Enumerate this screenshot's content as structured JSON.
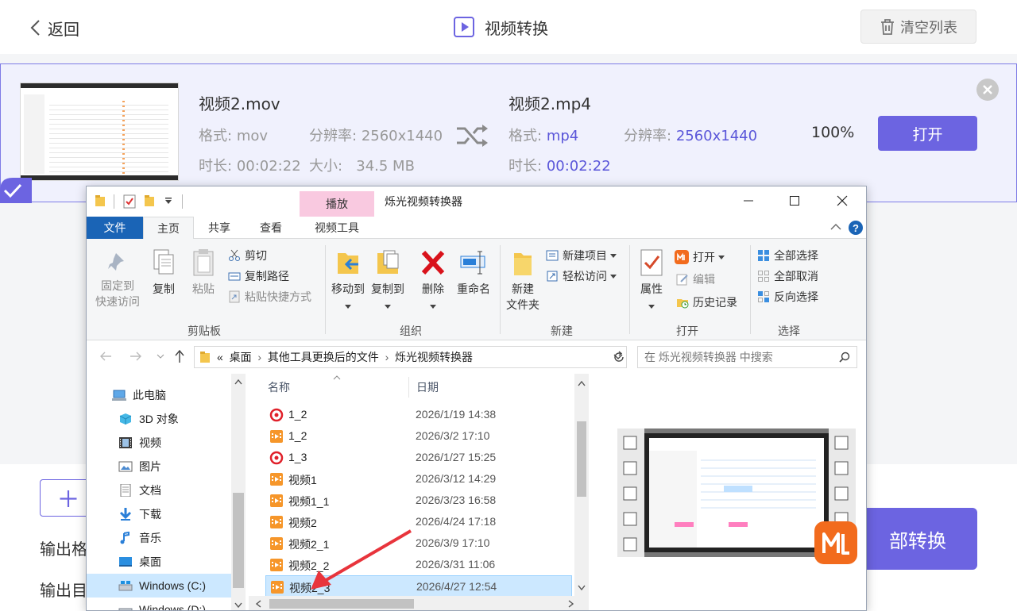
{
  "app": {
    "back_label": "返回",
    "title": "视频转换",
    "clear_label": "清空列表",
    "colors": {
      "accent": "#6c64e1"
    }
  },
  "task": {
    "source": {
      "filename": "视频2.mov",
      "format_label": "格式:",
      "format": "mov",
      "resolution_label": "分辨率:",
      "resolution": "2560x1440",
      "duration_label": "时长:",
      "duration": "00:02:22",
      "size_label": "大小:",
      "size": "34.5 MB"
    },
    "target": {
      "filename": "视频2.mp4",
      "format_label": "格式:",
      "format": "mp4",
      "resolution_label": "分辨率:",
      "resolution": "2560x1440",
      "duration_label": "时长:",
      "duration": "00:02:22"
    },
    "progress": "100%",
    "open_label": "打开"
  },
  "footer": {
    "output_format_label": "输出格",
    "output_dir_label": "输出目",
    "convert_all_label": "部转换"
  },
  "explorer": {
    "context_tab": "播放",
    "window_title": "烁光视频转换器",
    "tabs": [
      "文件",
      "主页",
      "共享",
      "查看",
      "视频工具"
    ],
    "ribbon": {
      "clipboard": {
        "pin_line1": "固定到",
        "pin_line2": "快速访问",
        "copy": "复制",
        "paste": "粘贴",
        "cut": "剪切",
        "copy_path": "复制路径",
        "paste_shortcut": "粘贴快捷方式",
        "group": "剪贴板"
      },
      "organize": {
        "move_to": "移动到",
        "copy_to": "复制到",
        "delete": "删除",
        "rename": "重命名",
        "group": "组织"
      },
      "new": {
        "new_folder_line1": "新建",
        "new_folder_line2": "文件夹",
        "new_item": "新建项目",
        "easy_access": "轻松访问",
        "group": "新建"
      },
      "open": {
        "properties": "属性",
        "open": "打开",
        "edit": "编辑",
        "history": "历史记录",
        "group": "打开"
      },
      "select": {
        "select_all": "全部选择",
        "select_none": "全部取消",
        "invert": "反向选择",
        "group": "选择"
      }
    },
    "address": {
      "prefix": "«",
      "crumbs": [
        "桌面",
        "其他工具更换后的文件",
        "烁光视频转换器"
      ],
      "search_placeholder": "在 烁光视频转换器 中搜索"
    },
    "nav": [
      {
        "label": "此电脑",
        "icon": "computer-icon"
      },
      {
        "label": "3D 对象",
        "icon": "cube-icon"
      },
      {
        "label": "视频",
        "icon": "film-icon"
      },
      {
        "label": "图片",
        "icon": "picture-icon"
      },
      {
        "label": "文档",
        "icon": "document-icon"
      },
      {
        "label": "下载",
        "icon": "download-arrow-icon"
      },
      {
        "label": "音乐",
        "icon": "music-note-icon"
      },
      {
        "label": "桌面",
        "icon": "desktop-icon"
      },
      {
        "label": "Windows (C:)",
        "icon": "drive-icon"
      },
      {
        "label": "Windows (D:)",
        "icon": "drive-icon"
      }
    ],
    "columns": {
      "name": "名称",
      "date": "日期"
    },
    "files": [
      {
        "name": "1_2",
        "date": "2026/1/19 14:38",
        "icon": "red-media-icon"
      },
      {
        "name": "1_2",
        "date": "2026/3/2 17:10",
        "icon": "orange-video-icon"
      },
      {
        "name": "1_3",
        "date": "2026/1/27 15:25",
        "icon": "red-media-icon"
      },
      {
        "name": "视频1",
        "date": "2026/3/12 14:29",
        "icon": "orange-video-icon"
      },
      {
        "name": "视频1_1",
        "date": "2026/3/23 16:58",
        "icon": "orange-video-icon"
      },
      {
        "name": "视频2",
        "date": "2026/4/24 17:18",
        "icon": "orange-video-icon"
      },
      {
        "name": "视频2_1",
        "date": "2026/3/9 17:10",
        "icon": "orange-video-icon"
      },
      {
        "name": "视频2_2",
        "date": "2026/3/31 11:06",
        "icon": "orange-video-icon"
      },
      {
        "name": "视频2_3",
        "date": "2026/4/27 12:54",
        "icon": "orange-video-icon",
        "selected": true
      }
    ]
  }
}
